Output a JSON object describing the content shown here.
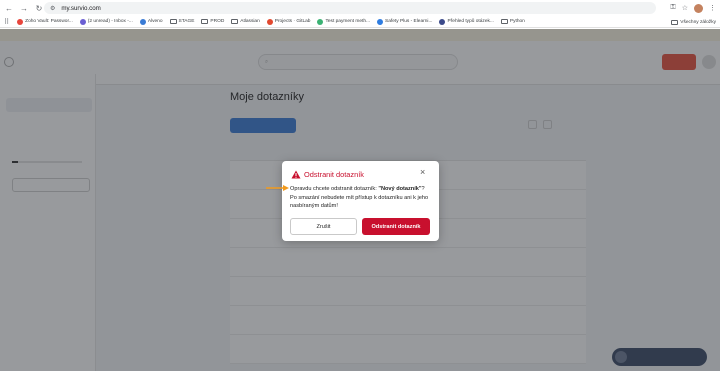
{
  "browser": {
    "url": "my.survio.com",
    "bookmarks": [
      {
        "label": "Zoho Vault: Passwor...",
        "icon": "zoho-icon",
        "color": "#e8453c"
      },
      {
        "label": "(2 unread) - Inbox -...",
        "icon": "mail-icon",
        "color": "#6b5fd3"
      },
      {
        "label": "Alveno",
        "icon": "alveno-icon",
        "color": "#3a7bd5"
      },
      {
        "label": "STAGE",
        "icon": "folder-icon",
        "color": ""
      },
      {
        "label": "PROD",
        "icon": "folder-icon",
        "color": ""
      },
      {
        "label": "Atlassian",
        "icon": "folder-icon",
        "color": ""
      },
      {
        "label": "Projects · GitLab",
        "icon": "gitlab-icon",
        "color": "#e2492f"
      },
      {
        "label": "Test payment meth...",
        "icon": "stripe-icon",
        "color": "#3bb273"
      },
      {
        "label": "Safety Plus - Elearni...",
        "icon": "safety-icon",
        "color": "#2f7de1"
      },
      {
        "label": "Přehled typů otázek...",
        "icon": "survio-icon",
        "color": "#3b4a8a"
      },
      {
        "label": "Python",
        "icon": "folder-icon",
        "color": ""
      }
    ],
    "bookmarks_right": "Všechny záložky"
  },
  "modal": {
    "title": "Odstranit dotazník",
    "question_prefix": "Opravdu chcete odstranit dotazník: ",
    "survey_name": "\"Nový dotazník\"",
    "question_suffix": "?",
    "warning": "Po smazání nebudete mít přístup k dotazníku ani k jeho nasbíraným datům!",
    "cancel_label": "Zrušit",
    "delete_label": "Odstranit dotazník",
    "accent_color": "#c8102e"
  },
  "page": {
    "title": "Moje dotazníky"
  }
}
